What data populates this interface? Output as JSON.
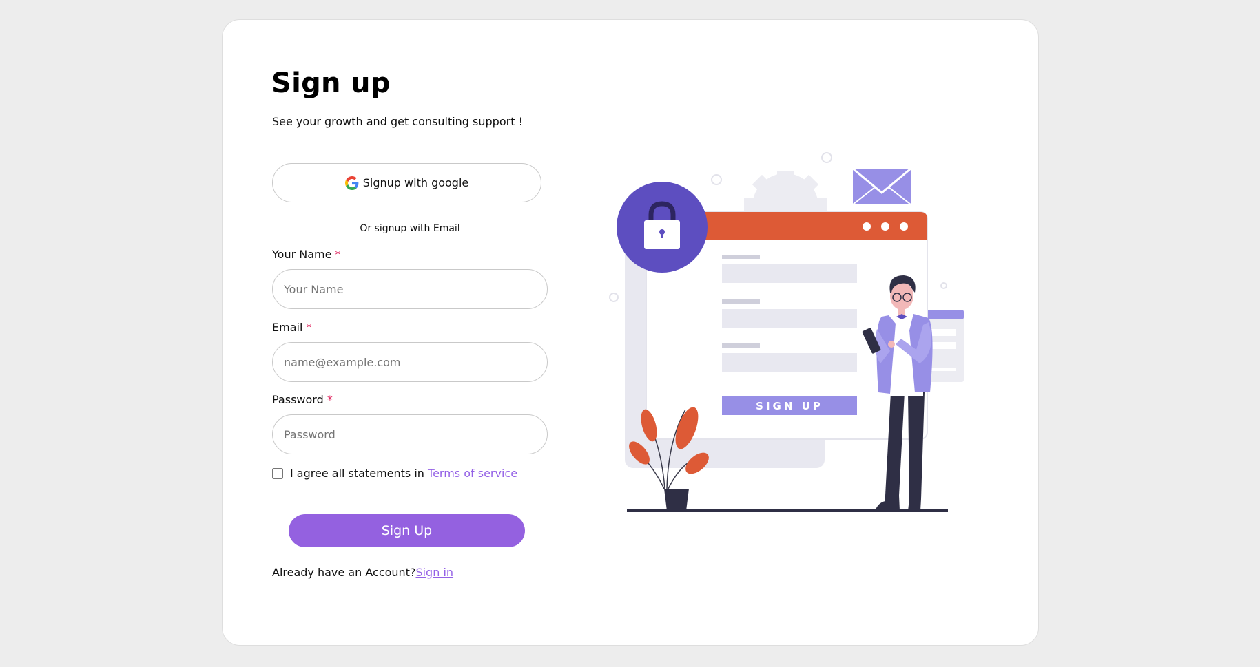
{
  "header": {
    "title": "Sign up",
    "subtitle": "See your growth and get consulting support !"
  },
  "google_button": {
    "label": "Signup with google",
    "icon": "google-icon"
  },
  "divider": {
    "text": "Or signup with Email"
  },
  "form": {
    "name": {
      "label": "Your Name",
      "required_mark": "*",
      "placeholder": "Your Name",
      "value": ""
    },
    "email": {
      "label": "Email",
      "required_mark": "*",
      "placeholder": "name@example.com",
      "value": ""
    },
    "password": {
      "label": "Password",
      "required_mark": "*",
      "placeholder": "Password",
      "value": ""
    }
  },
  "agreement": {
    "text": "I agree all statements in ",
    "link_text": "Terms of service",
    "checked": false
  },
  "submit": {
    "label": "Sign Up"
  },
  "footer": {
    "text": "Already have an Account?",
    "link_text": "Sign in"
  },
  "illustration": {
    "button_text": "SIGN UP"
  },
  "colors": {
    "accent": "#9461e0",
    "link": "#9461e6",
    "required": "#e0245e",
    "illustration_orange": "#dd5a36",
    "illustration_purple": "#5d4ec0",
    "illustration_lavender": "#978fe6",
    "background": "#ededed"
  }
}
